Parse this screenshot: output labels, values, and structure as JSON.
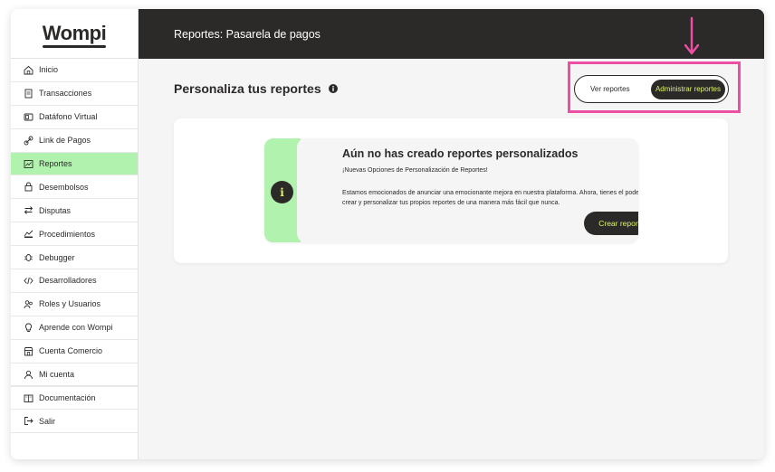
{
  "app": {
    "logo": "Wompi"
  },
  "header": {
    "title": "Reportes: Pasarela de pagos"
  },
  "sidebar": {
    "items": [
      {
        "label": "Inicio",
        "icon": "home-icon"
      },
      {
        "label": "Transacciones",
        "icon": "transactions-icon"
      },
      {
        "label": "Datáfono Virtual",
        "icon": "card-terminal-icon"
      },
      {
        "label": "Link de Pagos",
        "icon": "link-icon"
      },
      {
        "label": "Reportes",
        "icon": "chart-icon",
        "active": true
      },
      {
        "label": "Desembolsos",
        "icon": "lock-icon"
      },
      {
        "label": "Disputas",
        "icon": "swap-arrows-icon"
      },
      {
        "label": "Procedimientos",
        "icon": "procedures-icon"
      },
      {
        "label": "Debugger",
        "icon": "bug-icon"
      },
      {
        "label": "Desarrolladores",
        "icon": "code-icon"
      },
      {
        "label": "Roles y Usuarios",
        "icon": "users-icon"
      },
      {
        "label": "Aprende con Wompi",
        "icon": "lightbulb-icon"
      },
      {
        "label": "Cuenta Comercio",
        "icon": "store-icon"
      },
      {
        "label": "Mi cuenta",
        "icon": "user-icon"
      },
      {
        "label": "Documentación",
        "icon": "book-icon"
      },
      {
        "label": "Salir",
        "icon": "logout-icon"
      }
    ]
  },
  "main": {
    "title": "Personaliza  tus reportes",
    "toggle": {
      "option_1": "Ver reportes",
      "option_2": "Administrar reportes",
      "selected": "Administrar reportes"
    },
    "empty_card": {
      "title": "Aún no has creado reportes personalizados",
      "subtitle": "¡Nuevas Opciones de Personalización de Reportes!",
      "body": "Estamos emocionados de anunciar una emocionante mejora en nuestra plataforma. Ahora, tienes el poder de crear y personalizar tus propios reportes de una manera más fácil que nunca.",
      "button": "Crear reporte",
      "badge": "i"
    }
  },
  "colors": {
    "dark": "#2c2a29",
    "accent_green": "#b0f2ae",
    "accent_yellow": "#dff26b",
    "highlight_pink": "#ee4fa6"
  }
}
